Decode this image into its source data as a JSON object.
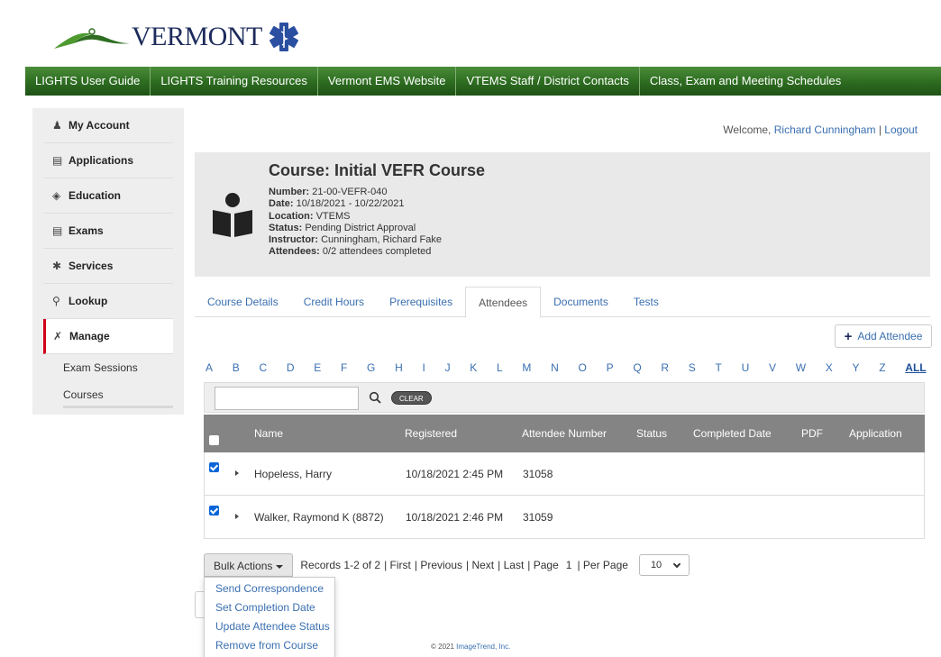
{
  "brand": {
    "logo_text": "VERMONT"
  },
  "topnav": [
    "LIGHTS User Guide",
    "LIGHTS Training Resources",
    "Vermont EMS Website",
    "VTEMS Staff / District Contacts",
    "Class, Exam and Meeting Schedules"
  ],
  "sidebar": {
    "items": [
      {
        "label": "My Account",
        "icon": "person-icon"
      },
      {
        "label": "Applications",
        "icon": "form-icon"
      },
      {
        "label": "Education",
        "icon": "graduation-cap-icon"
      },
      {
        "label": "Exams",
        "icon": "form-icon"
      },
      {
        "label": "Services",
        "icon": "asterisk-icon"
      },
      {
        "label": "Lookup",
        "icon": "search-icon"
      },
      {
        "label": "Manage",
        "icon": "tools-icon"
      }
    ],
    "subitems": [
      "Exam Sessions",
      "Courses"
    ],
    "active_color": "#d0021b"
  },
  "welcome": {
    "prefix": "Welcome,",
    "user": "Richard Cunningham",
    "sep": "|",
    "logout": "Logout"
  },
  "course": {
    "title": "Course: Initial VEFR Course",
    "fields": [
      {
        "label": "Number:",
        "value": "21-00-VEFR-040"
      },
      {
        "label": "Date:",
        "value": "10/18/2021 - 10/22/2021"
      },
      {
        "label": "Location:",
        "value": "VTEMS"
      },
      {
        "label": "Status:",
        "value": "Pending District Approval"
      },
      {
        "label": "Instructor:",
        "value": "Cunningham, Richard Fake"
      },
      {
        "label": "Attendees:",
        "value": "0/2 attendees completed"
      }
    ]
  },
  "tabs": [
    {
      "label": "Course Details",
      "active": false
    },
    {
      "label": "Credit Hours",
      "active": false
    },
    {
      "label": "Prerequisites",
      "active": false
    },
    {
      "label": "Attendees",
      "active": true
    },
    {
      "label": "Documents",
      "active": false
    },
    {
      "label": "Tests",
      "active": false
    }
  ],
  "add_attendee": "Add Attendee",
  "letters": [
    "A",
    "B",
    "C",
    "D",
    "E",
    "F",
    "G",
    "H",
    "I",
    "J",
    "K",
    "L",
    "M",
    "N",
    "O",
    "P",
    "Q",
    "R",
    "S",
    "T",
    "U",
    "V",
    "W",
    "X",
    "Y",
    "Z"
  ],
  "letters_all": "ALL",
  "search": {
    "value": "",
    "clear_label": "CLEAR"
  },
  "table": {
    "columns": [
      "Name",
      "Registered",
      "Attendee Number",
      "Status",
      "Completed Date",
      "PDF",
      "Application"
    ],
    "rows": [
      {
        "name": "Hopeless, Harry",
        "registered": "10/18/2021 2:45 PM",
        "number": "31058",
        "checked": true
      },
      {
        "name": "Walker, Raymond K (8872)",
        "registered": "10/18/2021 2:46 PM",
        "number": "31059",
        "checked": true
      }
    ]
  },
  "pager": {
    "bulk_label": "Bulk Actions",
    "records": "Records 1-2 of 2",
    "first": "| First",
    "previous": "| Previous",
    "next": "| Next",
    "last": "| Last",
    "page_label": "| Page",
    "page": "1",
    "per_page_label": "| Per Page",
    "per_page": "10"
  },
  "bulk_menu": [
    "Send Correspondence",
    "Set Completion Date",
    "Update Attendee Status",
    "Remove from Course"
  ],
  "footer": {
    "prefix": "© 2021",
    "company": "ImageTrend, Inc."
  },
  "colors": {
    "nav_green": "#2f6e22",
    "link_blue": "#3a6fb0",
    "table_header": "#848484",
    "checkbox_blue": "#0a66d8"
  }
}
